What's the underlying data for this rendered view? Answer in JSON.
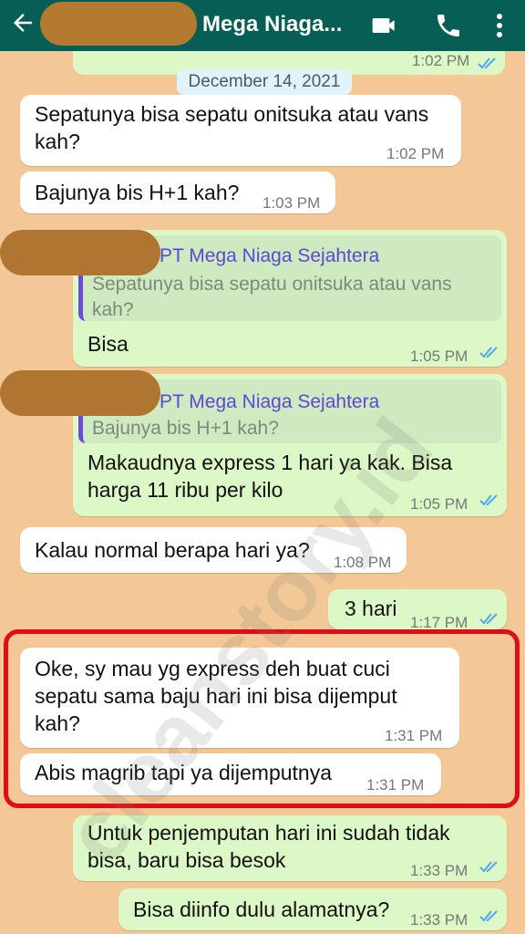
{
  "header": {
    "title": "Mega Niaga..."
  },
  "top_partial": {
    "time": "1:02 PM"
  },
  "date_label": "December 14, 2021",
  "messages": [
    {
      "text": "Sepatunya bisa sepatu onitsuka atau vans kah?",
      "time": "1:02 PM"
    },
    {
      "text": "Bajunya bis H+1 kah?",
      "time": "1:03 PM"
    },
    {
      "quote_sender": "PT Mega Niaga Sejahtera",
      "quote_text": "Sepatunya bisa sepatu onitsuka atau vans kah?",
      "text": "Bisa",
      "time": "1:05 PM"
    },
    {
      "quote_sender": "PT Mega Niaga Sejahtera",
      "quote_text": "Bajunya bis H+1 kah?",
      "text": "Makaudnya express 1 hari ya kak. Bisa harga 11 ribu per kilo",
      "time": "1:05 PM"
    },
    {
      "text": "Kalau normal berapa hari ya?",
      "time": "1:08 PM"
    },
    {
      "text": "3 hari",
      "time": "1:17 PM"
    },
    {
      "text": "Oke, sy mau yg express deh buat cuci sepatu sama baju hari ini bisa dijemput kah?",
      "time": "1:31 PM"
    },
    {
      "text": "Abis magrib tapi ya dijemputnya",
      "time": "1:31 PM"
    },
    {
      "text": "Untuk penjemputan hari ini sudah tidak bisa, baru bisa besok",
      "time": "1:33 PM"
    },
    {
      "text": "Bisa diinfo dulu alamatnya?",
      "time": "1:33 PM"
    }
  ],
  "watermark": "cleanstory.id",
  "colors": {
    "header": "#075e54",
    "incoming": "#ffffff",
    "outgoing": "#dcf8c6",
    "highlight": "#e10d16",
    "tick": "#4fa8f0"
  },
  "icons": [
    "back-arrow-icon",
    "video-call-icon",
    "phone-icon",
    "more-vertical-icon",
    "double-check-icon"
  ]
}
